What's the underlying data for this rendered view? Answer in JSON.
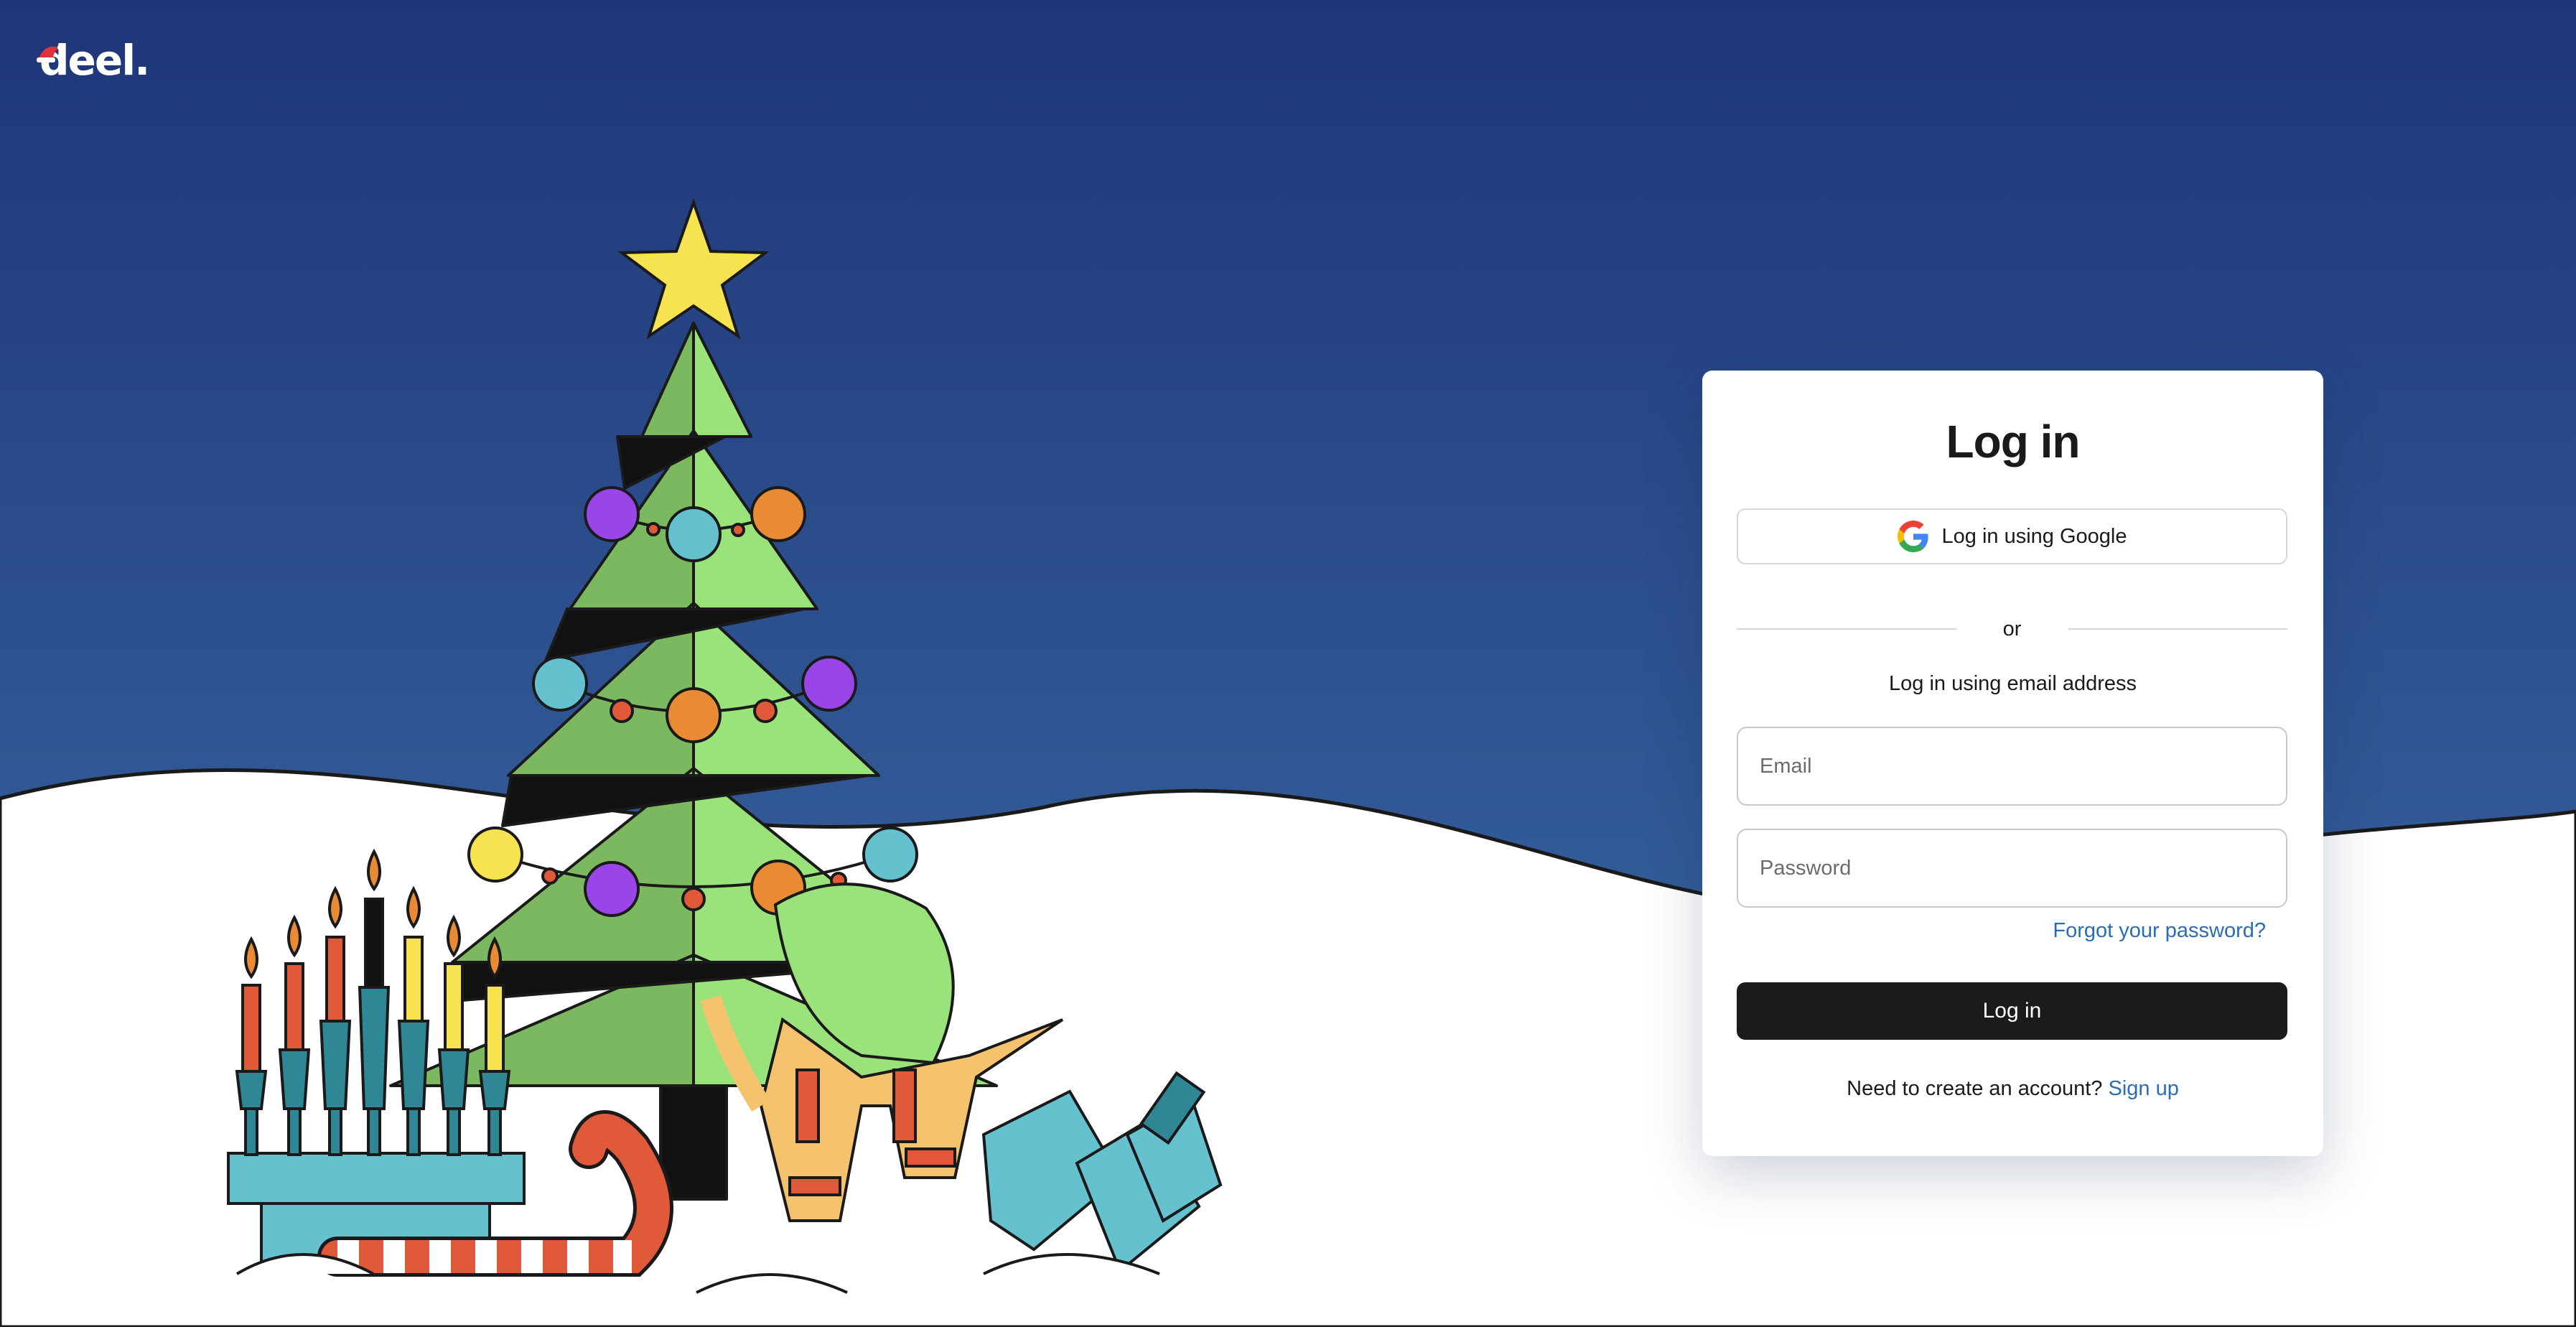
{
  "brand": {
    "logo_text": "deel."
  },
  "login": {
    "title": "Log in",
    "google_button_label": "Log in using Google",
    "divider_text": "or",
    "email_heading": "Log in using email address",
    "email_placeholder": "Email",
    "password_placeholder": "Password",
    "forgot_link": "Forgot your password?",
    "submit_label": "Log in",
    "signup_prompt": "Need to create an account?",
    "signup_link": "Sign up"
  },
  "colors": {
    "sky_top": "#1f3679",
    "sky_bottom": "#3c6ea6",
    "snow": "#ffffff",
    "button_dark": "#1b1b1b",
    "link_blue": "#2a6db5"
  },
  "icons": [
    "google-icon",
    "santa-hat-icon"
  ]
}
